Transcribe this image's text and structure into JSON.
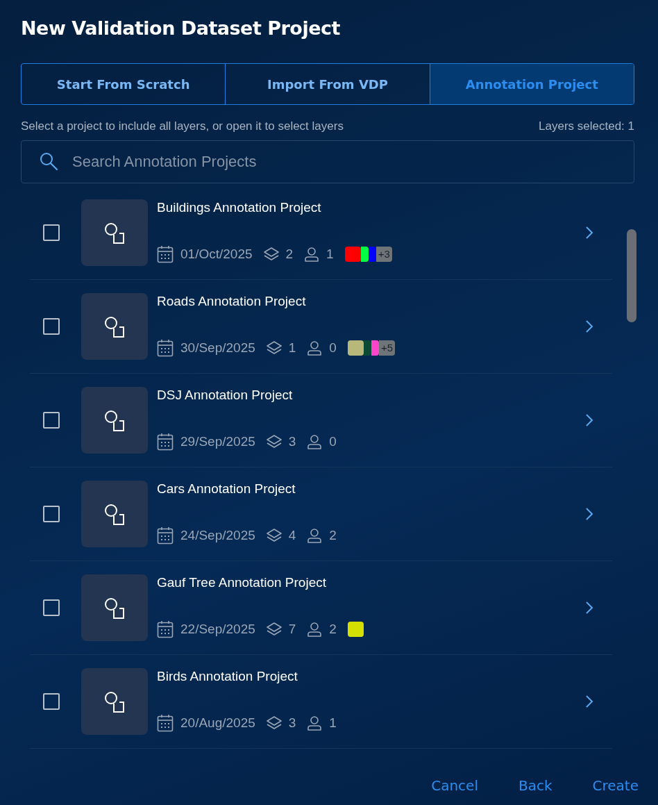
{
  "title": "New Validation Dataset Project",
  "tabs": [
    {
      "label": "Start From Scratch",
      "selected": false
    },
    {
      "label": "Import From VDP",
      "selected": false
    },
    {
      "label": "Annotation Project",
      "selected": true
    }
  ],
  "hint": "Select a project to include all layers, or open it to select layers",
  "layers_selected": "Layers selected: 1",
  "search": {
    "placeholder": "Search Annotation Projects"
  },
  "projects": [
    {
      "name": "Buildings Annotation Project",
      "checked": false,
      "date": "01/Oct/2025",
      "layers": "2",
      "users": "1",
      "colors": [
        {
          "color": "#ff0000"
        },
        {
          "color": "#00ff44"
        },
        {
          "color": "#0000ff"
        }
      ],
      "more": "+3"
    },
    {
      "name": "Roads Annotation Project",
      "checked": false,
      "date": "30/Sep/2025",
      "layers": "1",
      "users": "0",
      "colors": [
        {
          "color": "#b8b87a"
        },
        {
          "color": "#0b4a33"
        },
        {
          "color": "#ff44cc"
        }
      ],
      "more": "+5"
    },
    {
      "name": "DSJ Annotation Project",
      "checked": false,
      "date": "29/Sep/2025",
      "layers": "3",
      "users": "0"
    },
    {
      "name": "Cars Annotation Project",
      "checked": false,
      "date": "24/Sep/2025",
      "layers": "4",
      "users": "2"
    },
    {
      "name": "Gauf Tree Annotation Project",
      "checked": false,
      "date": "22/Sep/2025",
      "layers": "7",
      "users": "2",
      "colors": [
        {
          "color": "#d4e000"
        }
      ]
    },
    {
      "name": "Birds Annotation Project",
      "checked": false,
      "date": "20/Aug/2025",
      "layers": "3",
      "users": "1"
    }
  ],
  "buttons": [
    "Cancel",
    "Back",
    "Create"
  ]
}
